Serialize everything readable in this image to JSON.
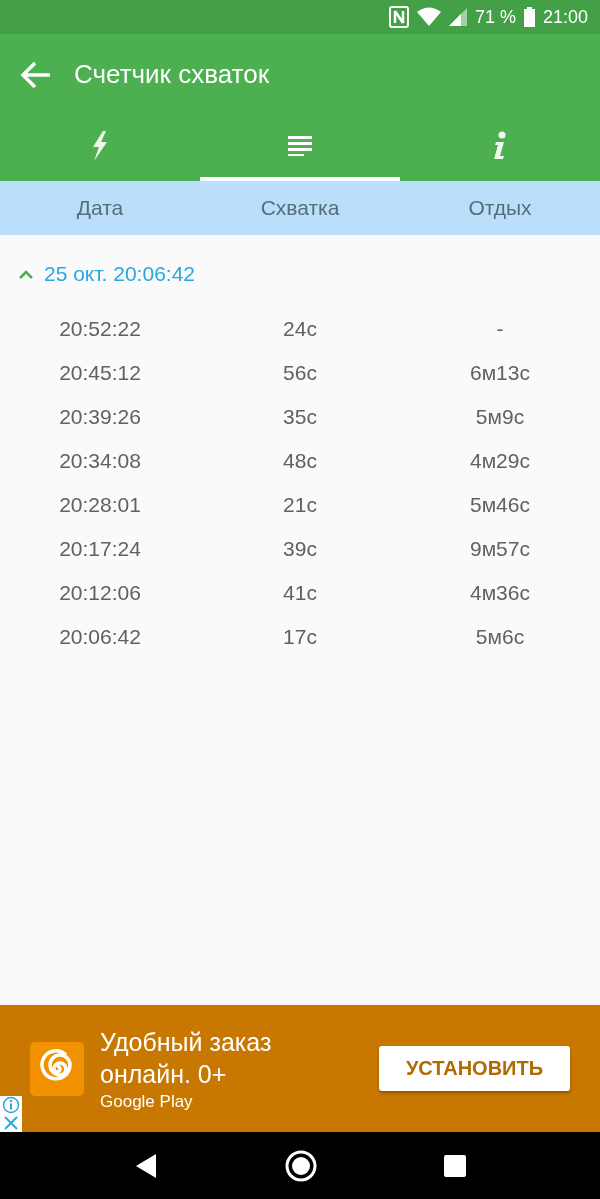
{
  "status_bar": {
    "battery": "71 %",
    "time": "21:00"
  },
  "app_bar": {
    "title": "Счетчик схваток"
  },
  "tabs": [
    {
      "kind": "bolt",
      "selected": false
    },
    {
      "kind": "list",
      "selected": true
    },
    {
      "kind": "info",
      "selected": false
    }
  ],
  "table": {
    "columns": [
      "Дата",
      "Схватка",
      "Отдых"
    ],
    "group": {
      "title": "25 окт. 20:06:42",
      "expanded": true
    },
    "rows": [
      [
        "20:52:22",
        "24с",
        "-"
      ],
      [
        "20:45:12",
        "56с",
        "6м13с"
      ],
      [
        "20:39:26",
        "35с",
        "5м9с"
      ],
      [
        "20:34:08",
        "48с",
        "4м29с"
      ],
      [
        "20:28:01",
        "21с",
        "5м46с"
      ],
      [
        "20:17:24",
        "39с",
        "9м57с"
      ],
      [
        "20:12:06",
        "41с",
        "4м36с"
      ],
      [
        "20:06:42",
        "17с",
        "5м6с"
      ]
    ]
  },
  "ad": {
    "headline": "Удобный заказ онлайн. 0+",
    "store": "Google Play",
    "button": "УСТАНОВИТЬ"
  }
}
